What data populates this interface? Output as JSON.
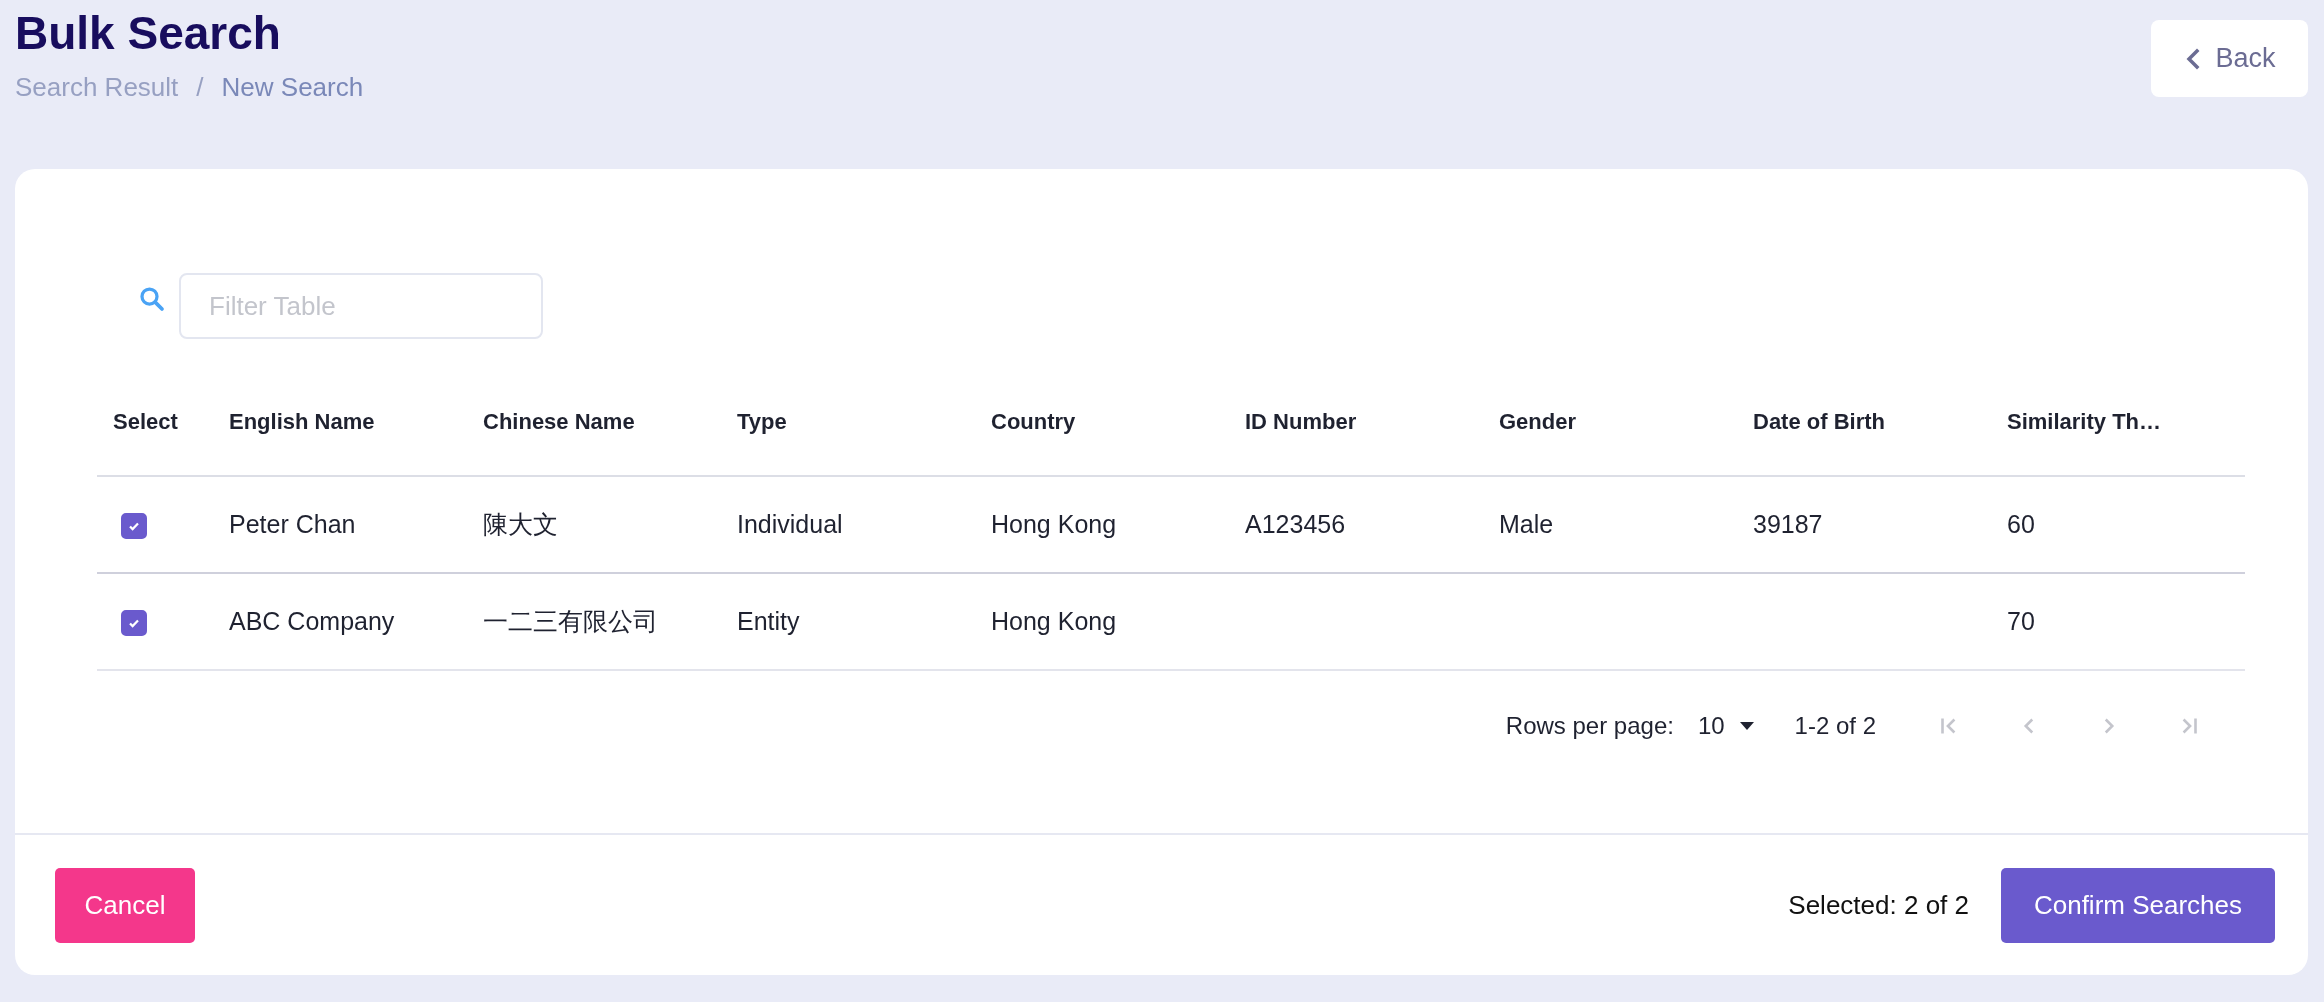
{
  "header": {
    "title": "Bulk Search",
    "breadcrumb": [
      {
        "label": "Search Result",
        "current": false
      },
      {
        "label": "New Search",
        "current": true
      }
    ],
    "breadcrumb_separator": "/",
    "back_button": "Back"
  },
  "filter": {
    "placeholder": "Filter Table"
  },
  "table": {
    "select_header": "Select",
    "columns": [
      "English Name",
      "Chinese Name",
      "Type",
      "Country",
      "ID Number",
      "Gender",
      "Date of Birth",
      "Similarity Th…"
    ],
    "rows": [
      {
        "checked": true,
        "cells": [
          "Peter Chan",
          "陳大文",
          "Individual",
          "Hong Kong",
          "A123456",
          "Male",
          "39187",
          "60"
        ]
      },
      {
        "checked": true,
        "cells": [
          "ABC Company",
          "一二三有限公司",
          "Entity",
          "Hong Kong",
          "",
          "",
          "",
          "70"
        ]
      }
    ]
  },
  "pagination": {
    "rows_per_page_label": "Rows per page:",
    "rows_per_page": "10",
    "range": "1-2 of 2",
    "buttons": [
      {
        "kind": "first",
        "disabled": true
      },
      {
        "kind": "prev",
        "disabled": true
      },
      {
        "kind": "next",
        "disabled": true
      },
      {
        "kind": "last",
        "disabled": true
      }
    ]
  },
  "footer": {
    "cancel": "Cancel",
    "selected": "Selected: 2 of 2",
    "confirm": "Confirm Searches"
  }
}
